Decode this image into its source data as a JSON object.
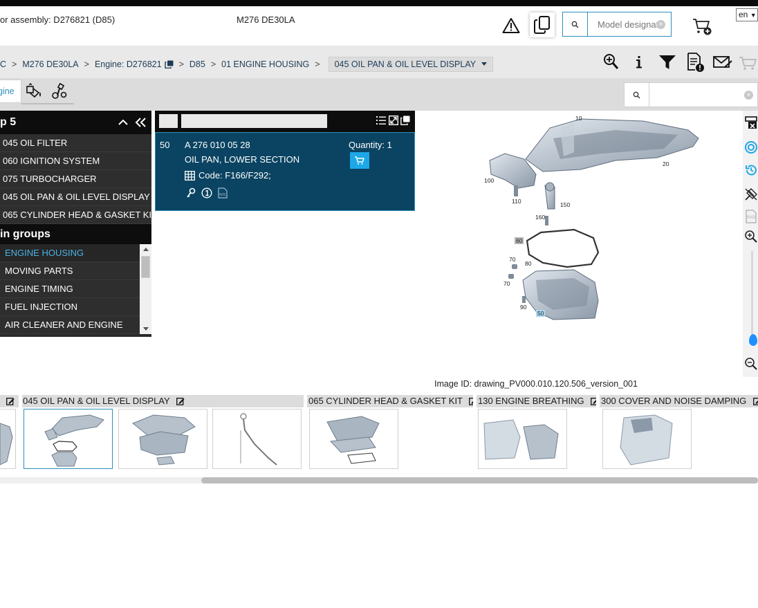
{
  "header": {
    "assembly_text": "or assembly: D276821 (D85)",
    "model_text": "M276 DE30LA",
    "search_placeholder": "Model designat",
    "language": "en"
  },
  "breadcrumb": {
    "items": [
      "C",
      "M276 DE30LA",
      "Engine: D276821",
      "D85",
      "01 ENGINE HOUSING"
    ],
    "active": "045 OIL PAN & OIL LEVEL DISPLAY"
  },
  "tabs": {
    "engine_label": "gine"
  },
  "left_panel": {
    "title": "p 5",
    "subgroups": [
      "045 OIL FILTER",
      "060 IGNITION SYSTEM",
      "075 TURBOCHARGER",
      "045 OIL PAN & OIL LEVEL DISPLAY",
      "065 CYLINDER HEAD & GASKET KIT"
    ],
    "main_groups_title": "in groups",
    "main_groups": [
      "ENGINE HOUSING",
      "MOVING PARTS",
      "ENGINE TIMING",
      "FUEL INJECTION",
      "AIR CLEANER AND ENGINE"
    ],
    "selected_main_group": 0
  },
  "part": {
    "position": "50",
    "number": "A 276 010 05 28",
    "description": "OIL PAN, LOWER SECTION",
    "code": "Code: F166/F292;",
    "quantity": "Quantity: 1",
    "wis_label": "WIS"
  },
  "drawing": {
    "callouts": [
      "10",
      "20",
      "100",
      "110",
      "150",
      "160",
      "60",
      "70",
      "80",
      "70",
      "90",
      "50"
    ],
    "image_id": "Image ID: drawing_PV000.010.120.506_version_001",
    "svg_label": "SVG"
  },
  "thumb_groups": [
    "045 OIL PAN & OIL LEVEL DISPLAY",
    "065 CYLINDER HEAD & GASKET KIT",
    "130 ENGINE BREATHING",
    "300 COVER AND NOISE DAMPING"
  ],
  "colors": {
    "accent": "#2a8fb8",
    "selected_row": "#0b4462",
    "cart_button": "#1ea7e8",
    "panel_dark": "#0d0d0d",
    "panel_item": "#2e2e2e"
  }
}
